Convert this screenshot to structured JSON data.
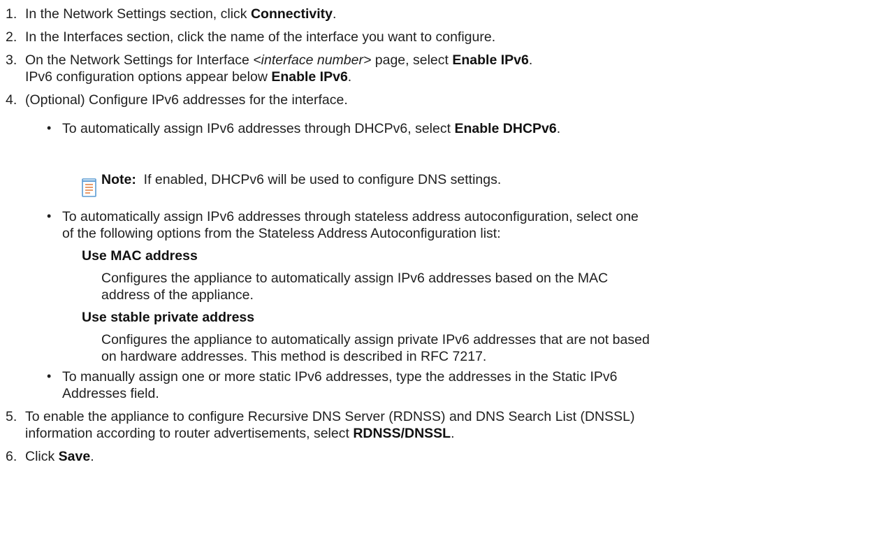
{
  "steps": [
    {
      "num": "1.",
      "pre": "In the Network Settings section, click ",
      "bold": "Connectivity",
      "post": "."
    },
    {
      "num": "2.",
      "text": "In the Interfaces section, click the name of the interface you want to configure."
    },
    {
      "num": "3.",
      "pre": "On the Network Settings for Interface ",
      "italic": "<interface number>",
      "mid": " page, select ",
      "bold": "Enable IPv6",
      "post": ".",
      "line2_pre": "IPv6 configuration options appear below ",
      "line2_bold": "Enable IPv6",
      "line2_post": "."
    },
    {
      "num": "4.",
      "text": "(Optional) Configure IPv6 addresses for the interface."
    },
    {
      "num": "5.",
      "line1": "To enable the appliance to configure Recursive DNS Server (RDNSS) and DNS Search List (DNSSL)",
      "line2_pre": "information according to router advertisements, select ",
      "line2_bold": "RDNSS/DNSSL",
      "line2_post": "."
    },
    {
      "num": "6.",
      "pre": "Click ",
      "bold": "Save",
      "post": "."
    }
  ],
  "bullets": {
    "b1": {
      "pre": "To automatically assign IPv6 addresses through DHCPv6, select ",
      "bold": "Enable DHCPv6",
      "post": "."
    },
    "note": {
      "label": "Note:",
      "text": "If enabled, DHCPv6 will be used to configure DNS settings."
    },
    "b2": {
      "line1": "To automatically assign IPv6 addresses through stateless address autoconfiguration, select one",
      "line2": "of the following options from the Stateless Address Autoconfiguration list:"
    },
    "defs": [
      {
        "term": "Use MAC address",
        "desc1": "Configures the appliance to automatically assign IPv6 addresses based on the MAC",
        "desc2": "address of the appliance."
      },
      {
        "term": "Use stable private address",
        "desc1": "Configures the appliance to automatically assign private IPv6 addresses that are not based",
        "desc2": "on hardware addresses. This method is described in RFC 7217."
      }
    ],
    "b3": {
      "line1": "To manually assign one or more static IPv6 addresses, type the addresses in the Static IPv6",
      "line2": "Addresses field."
    },
    "bullet_char": "•"
  },
  "colors": {
    "text": "#1f1f1f",
    "note_icon": "#5a9bd4",
    "note_lines": "#e07a3a"
  },
  "icons": {
    "note": "note-icon"
  }
}
